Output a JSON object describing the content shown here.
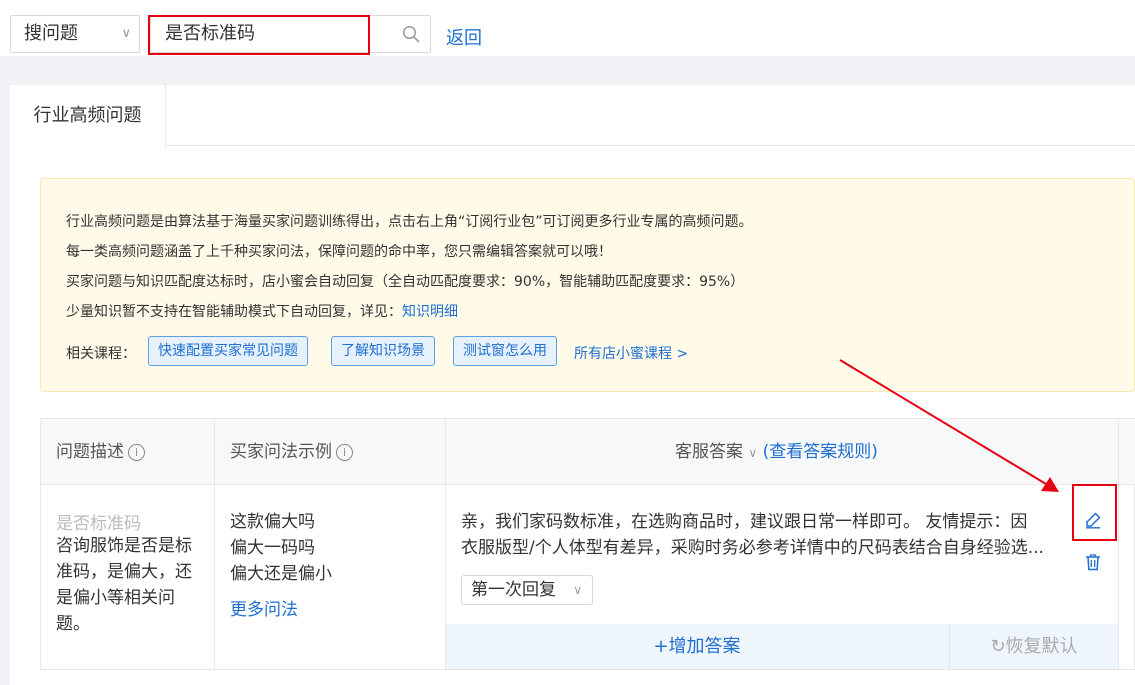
{
  "search_bar": {
    "scope_select": "搜问题",
    "query": "是否标准码",
    "back_link": "返回"
  },
  "tabs": [
    {
      "label": "行业高频问题"
    }
  ],
  "notice": {
    "line1": "行业高频问题是由算法基于海量买家问题训练得出，点击右上角“订阅行业包”可订阅更多行业专属的高频问题。",
    "line2": "每一类高频问题涵盖了上千种买家问法，保障问题的命中率，您只需编辑答案就可以哦！",
    "line3": "买家问题与知识匹配度达标时，店小蜜会自动回复（全自动匹配度要求：90%，智能辅助匹配度要求：95%）",
    "line4_text": "少量知识暂不支持在智能辅助模式下自动回复，详见：",
    "line4_link": "知识明细",
    "courses_label": "相关课程：",
    "courses": [
      "快速配置买家常见问题",
      "了解知识场景",
      "测试窗怎么用"
    ],
    "all_courses": "所有店小蜜课程 >"
  },
  "table": {
    "headers": {
      "question": "问题描述",
      "examples": "买家问法示例",
      "answer": "客服答案",
      "answer_rule_link": "(查看答案规则)"
    },
    "row": {
      "question_title": "是否标准码",
      "question_desc": "咨询服饰是否是标准码，是偏大，还是偏小等相关问题。",
      "examples": [
        "这款偏大吗",
        "偏大一码吗",
        "偏大还是偏小"
      ],
      "more_examples": "更多问法",
      "answer_line1": "亲，我们家码数标准，在选购商品时，建议跟日常一样即可。 友情提示：因",
      "answer_line2": "衣服版型/个人体型有差异，采购时务必参考详情中的尺码表结合自身经验选...",
      "reply_select": "第一次回复",
      "add_answer": "+增加答案",
      "restore_default": "恢复默认"
    }
  },
  "colors": {
    "link": "#1f6fd1",
    "highlight": "#e60012",
    "notice_bg": "#fffbe8"
  },
  "icons": [
    "search-icon",
    "chevron-down-icon",
    "info-icon",
    "edit-icon",
    "trash-icon",
    "refresh-icon"
  ]
}
